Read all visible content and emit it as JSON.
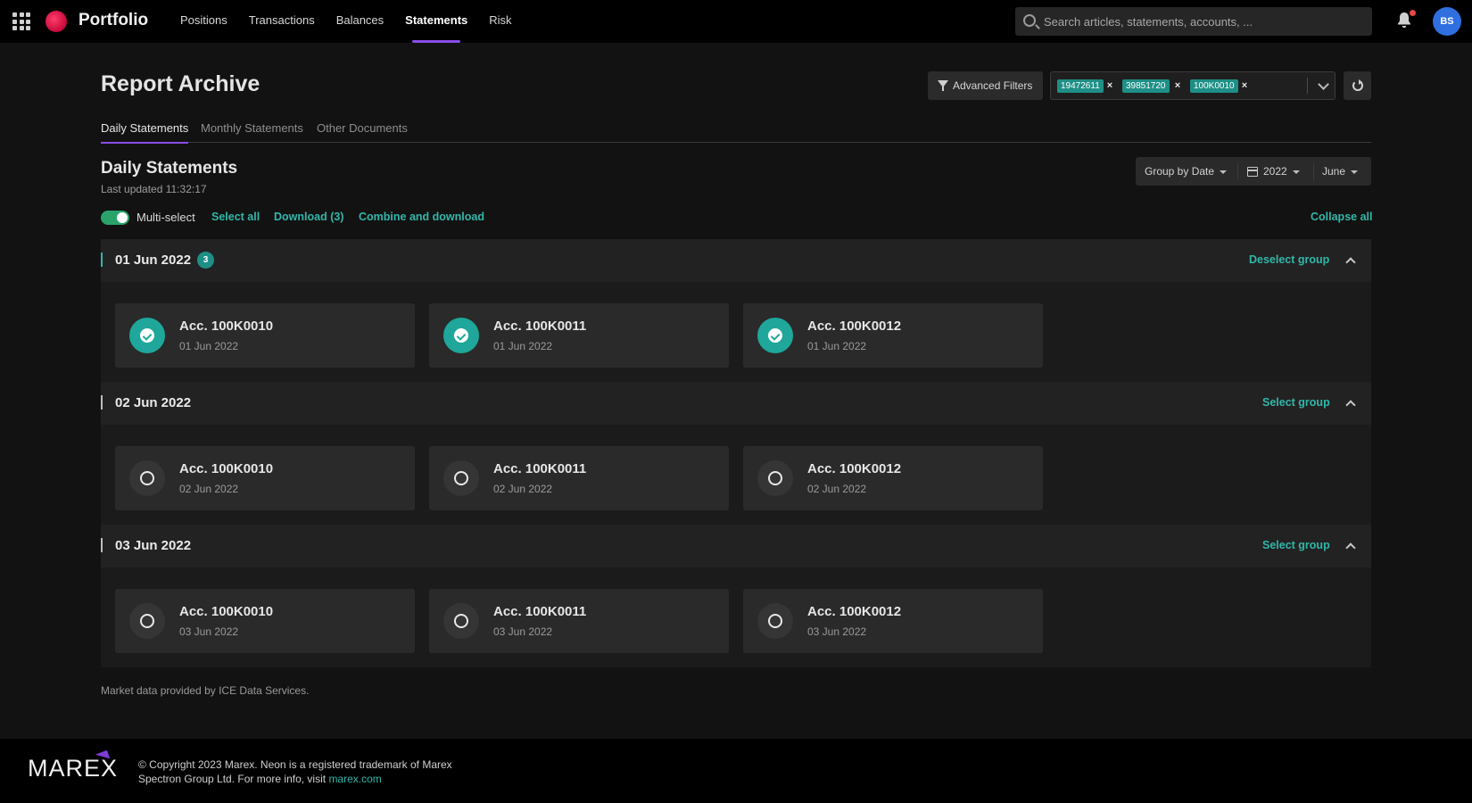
{
  "app": {
    "brand": "Portfolio"
  },
  "nav": {
    "links": [
      "Positions",
      "Transactions",
      "Balances",
      "Statements",
      "Risk"
    ],
    "active": "Statements"
  },
  "search": {
    "placeholder": "Search articles, statements, accounts, ..."
  },
  "user": {
    "initials": "BS"
  },
  "page": {
    "title": "Report Archive"
  },
  "filters": {
    "advanced_label": "Advanced Filters",
    "tags": [
      "19472611",
      "39851720",
      "100K0010"
    ]
  },
  "tabs": [
    "Daily Statements",
    "Monthly Statements",
    "Other Documents"
  ],
  "section": {
    "title": "Daily Statements",
    "last_updated": "Last updated 11:32:17",
    "group_by": "Group by Date",
    "year": "2022",
    "month": "June"
  },
  "toolbar": {
    "multi_select_label": "Multi-select",
    "multi_select_on": true,
    "select_all": "Select all",
    "download": "Download (3)",
    "combine": "Combine and download",
    "collapse_all": "Collapse all"
  },
  "groups": [
    {
      "date": "01 Jun 2022",
      "count": "3",
      "action": "Deselect group",
      "selected": true,
      "cards": [
        {
          "account": "Acc. 100K0010",
          "date": "01 Jun 2022"
        },
        {
          "account": "Acc. 100K0011",
          "date": "01 Jun 2022"
        },
        {
          "account": "Acc. 100K0012",
          "date": "01 Jun 2022"
        }
      ]
    },
    {
      "date": "02 Jun 2022",
      "action": "Select group",
      "selected": false,
      "cards": [
        {
          "account": "Acc. 100K0010",
          "date": "02 Jun 2022"
        },
        {
          "account": "Acc. 100K0011",
          "date": "02 Jun 2022"
        },
        {
          "account": "Acc. 100K0012",
          "date": "02 Jun 2022"
        }
      ]
    },
    {
      "date": "03 Jun 2022",
      "action": "Select group",
      "selected": false,
      "cards": [
        {
          "account": "Acc. 100K0010",
          "date": "03 Jun 2022"
        },
        {
          "account": "Acc. 100K0011",
          "date": "03 Jun 2022"
        },
        {
          "account": "Acc. 100K0012",
          "date": "03 Jun 2022"
        }
      ]
    }
  ],
  "market_note": "Market data provided by ICE Data Services.",
  "footer": {
    "logo_text": "MAREX",
    "copyright": "© Copyright 2023 Marex. Neon is a registered trademark of Marex Spectron Group Ltd. For more info, visit",
    "link": "marex.com"
  },
  "colors": {
    "accent": "#31b7a9",
    "nav_active": "#8a4de8",
    "toggle_on": "#2aa36b",
    "avatar": "#2f6fe0"
  }
}
